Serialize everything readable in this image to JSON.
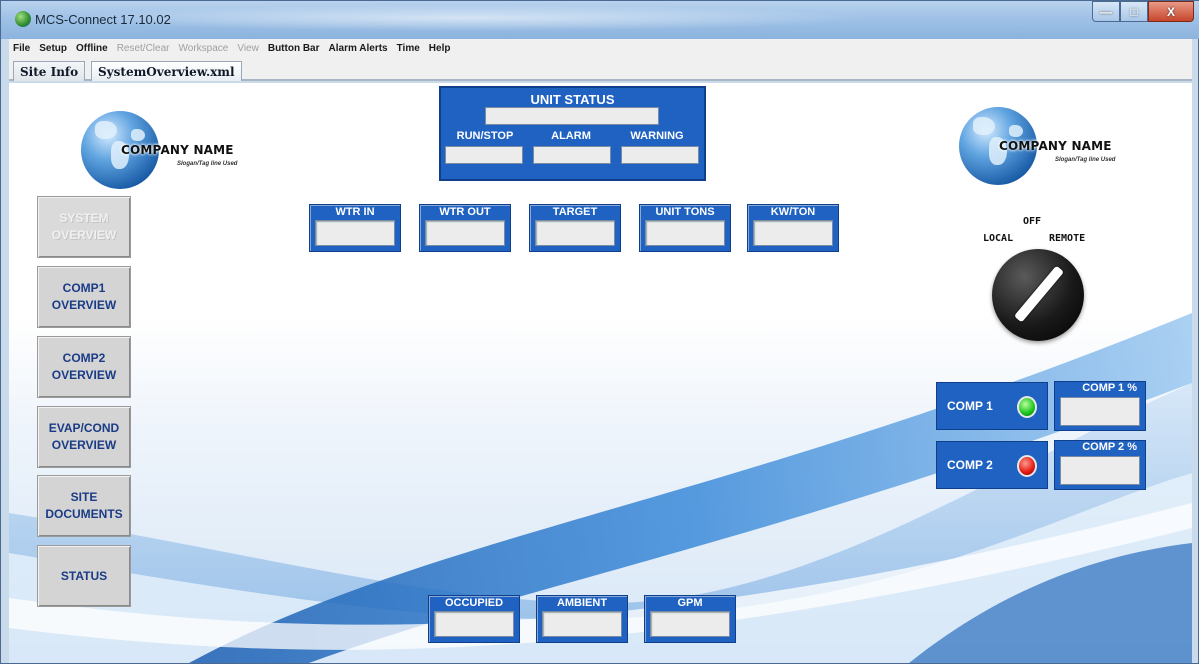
{
  "window": {
    "title": "MCS-Connect 17.10.02",
    "controls": {
      "minimize": "—",
      "maximize": "□",
      "close": "X"
    }
  },
  "menu": [
    {
      "label": "File",
      "enabled": true
    },
    {
      "label": "Setup",
      "enabled": true
    },
    {
      "label": "Offline",
      "enabled": true
    },
    {
      "label": "Reset/Clear",
      "enabled": false
    },
    {
      "label": "Workspace",
      "enabled": false
    },
    {
      "label": "View",
      "enabled": false
    },
    {
      "label": "Button Bar",
      "enabled": true
    },
    {
      "label": "Alarm Alerts",
      "enabled": true
    },
    {
      "label": "Time",
      "enabled": true
    },
    {
      "label": "Help",
      "enabled": true
    }
  ],
  "tabs": [
    {
      "label": "Site Info",
      "active": false
    },
    {
      "label": "SystemOverview.xml",
      "active": true
    }
  ],
  "logo": {
    "company": "COMPANY NAME",
    "slogan": "Slogan/Tag line Used"
  },
  "unit_status": {
    "title": "UNIT STATUS",
    "main_value": "",
    "fields": [
      {
        "label": "RUN/STOP",
        "value": ""
      },
      {
        "label": "ALARM",
        "value": ""
      },
      {
        "label": "WARNING",
        "value": ""
      }
    ]
  },
  "nav": [
    {
      "label": "SYSTEM\nOVERVIEW",
      "enabled": false
    },
    {
      "label": "COMP1\nOVERVIEW",
      "enabled": true
    },
    {
      "label": "COMP2\nOVERVIEW",
      "enabled": true
    },
    {
      "label": "EVAP/COND\nOVERVIEW",
      "enabled": true
    },
    {
      "label": "SITE\nDOCUMENTS",
      "enabled": true
    },
    {
      "label": "STATUS",
      "enabled": true
    }
  ],
  "top_readouts": [
    {
      "label": "WTR IN",
      "value": ""
    },
    {
      "label": "WTR OUT",
      "value": ""
    },
    {
      "label": "TARGET",
      "value": ""
    },
    {
      "label": "UNIT TONS",
      "value": ""
    },
    {
      "label": "KW/TON",
      "value": ""
    }
  ],
  "bottom_readouts": [
    {
      "label": "OCCUPIED",
      "value": ""
    },
    {
      "label": "AMBIENT",
      "value": ""
    },
    {
      "label": "GPM",
      "value": ""
    }
  ],
  "selector": {
    "off": "OFF",
    "local": "LOCAL",
    "remote": "REMOTE"
  },
  "compressors": [
    {
      "label": "COMP 1",
      "status": "green",
      "pct_label": "COMP 1 %",
      "pct_value": ""
    },
    {
      "label": "COMP 2",
      "status": "red",
      "pct_label": "COMP 2 %",
      "pct_value": ""
    }
  ],
  "colors": {
    "panel_blue": "#1f62c2",
    "nav_text": "#1a3b86",
    "led_on": "#19c21c",
    "led_alarm": "#e3170f"
  }
}
